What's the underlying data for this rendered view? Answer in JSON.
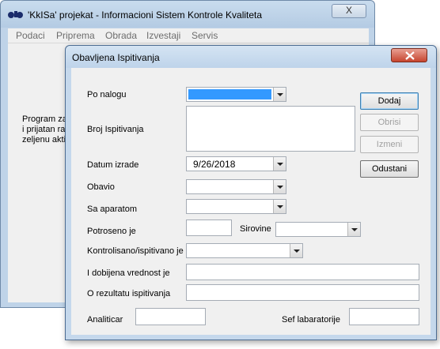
{
  "main_window": {
    "title": "'KkISa' projekat - Informacioni Sistem Kontrole Kvaliteta",
    "close_label": "X",
    "menu": [
      "Podaci",
      "Priprema",
      "Obrada",
      "Izvestaji",
      "Servis"
    ],
    "body_text": "Program za\ni prijatan rad\nzeljenu akti"
  },
  "dialog": {
    "title": "Obavljena Ispitivanja",
    "fields": {
      "po_nalogu": "Po nalogu",
      "broj_ispitivanja": "Broj Ispitivanja",
      "datum_izrade": "Datum izrade",
      "datum_value": "9/26/2018",
      "obavio": "Obavio",
      "sa_aparatom": "Sa aparatom",
      "potroseno_je": "Potroseno je",
      "sirovine": "Sirovine",
      "kontrolisano": "Kontrolisano/ispitivano je",
      "dobijena": "I dobijena vrednost je",
      "rezultat": "O rezultatu ispitivanja",
      "analiticar": "Analiticar",
      "sef": "Sef labaratorije"
    },
    "buttons": {
      "dodaj": "Dodaj",
      "obrisi": "Obrisi",
      "izmeni": "Izmeni",
      "odustani": "Odustani"
    }
  }
}
